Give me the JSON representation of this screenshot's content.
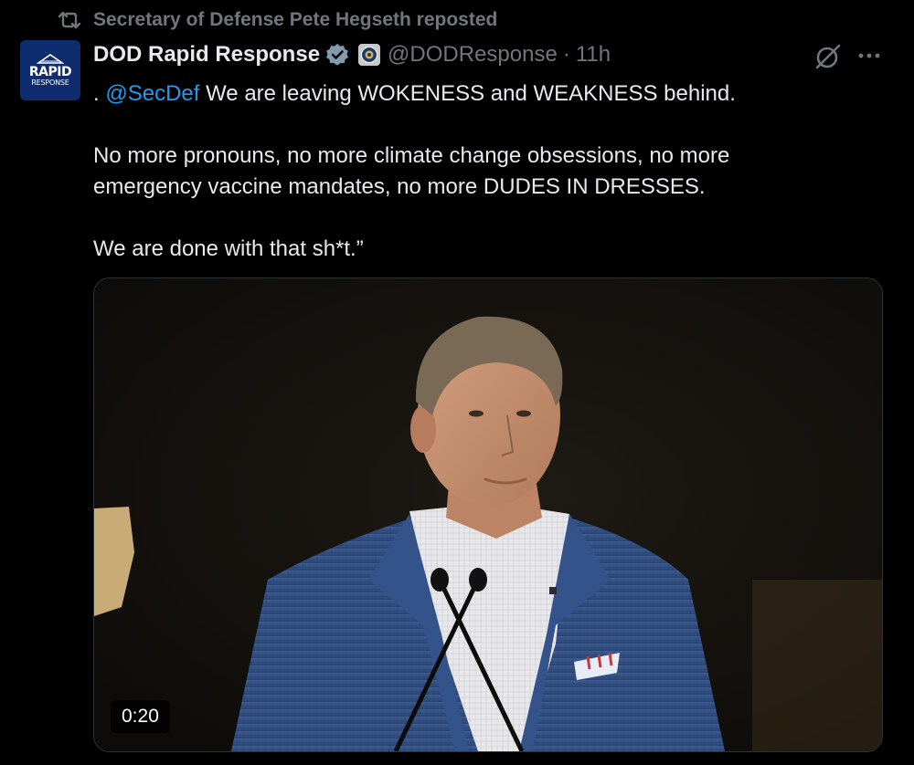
{
  "repost": {
    "text": "Secretary of Defense Pete Hegseth reposted",
    "icon": "repost-icon"
  },
  "author": {
    "display_name": "DOD Rapid Response",
    "handle": "@DODResponse",
    "separator": "·",
    "time": "11h",
    "avatar_text_main": "RAPID",
    "avatar_text_sub": "RESPONSE",
    "verified": true
  },
  "tweet": {
    "line1_prefix": ". ",
    "mention": "@SecDef",
    "line1_rest": " We are leaving WOKENESS and WEAKNESS behind.",
    "paragraph2": "No more pronouns, no more climate change obsessions, no more emergency vaccine mandates, no more DUDES IN DRESSES.",
    "paragraph3": "We are done with that sh*t.”"
  },
  "media": {
    "type": "video",
    "duration": "0:20"
  },
  "colors": {
    "background": "#000000",
    "text": "#e7e9ea",
    "secondary": "#71767b",
    "link": "#1d9bf0",
    "verified": "#829aab"
  }
}
